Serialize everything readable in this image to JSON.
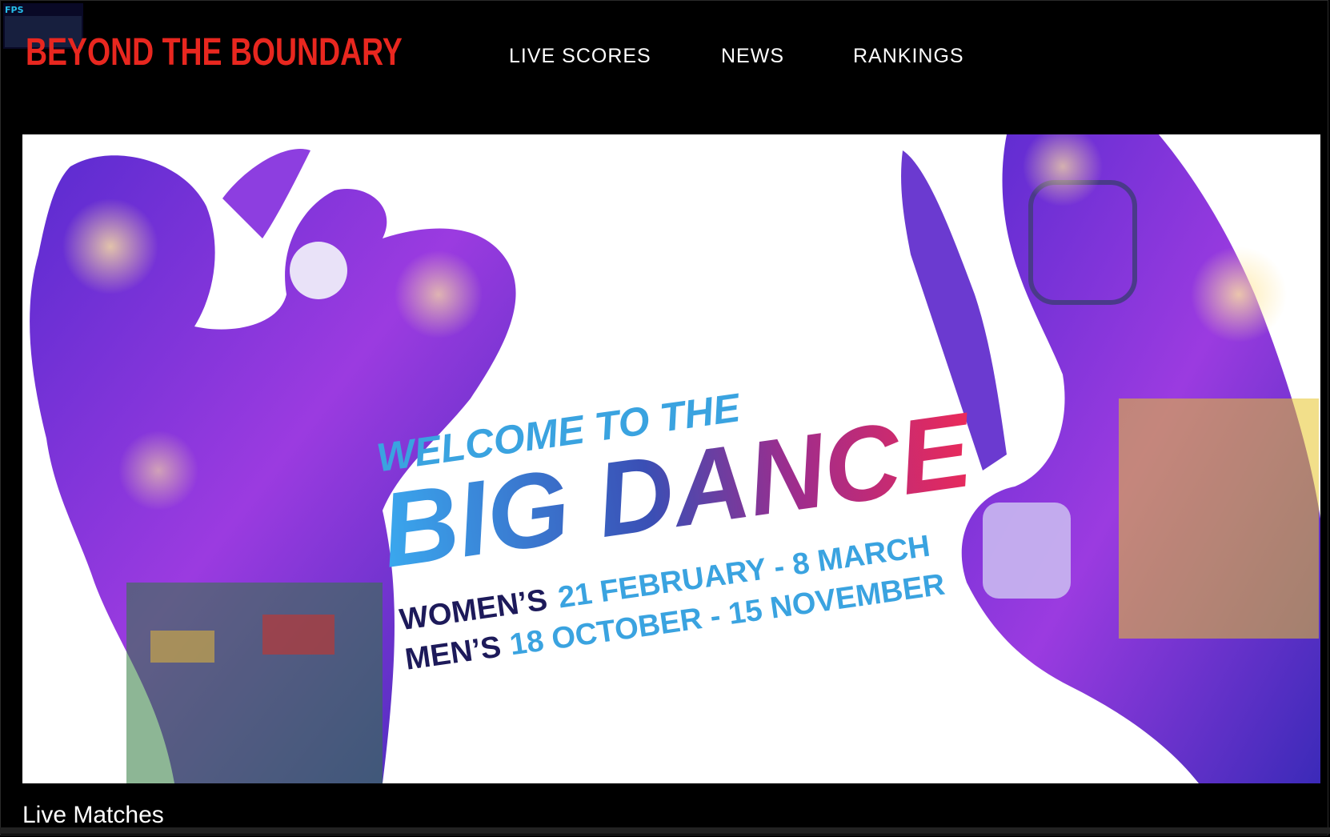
{
  "fps_overlay": {
    "label": "FPS"
  },
  "header": {
    "logo_text": "BEYOND THE BOUNDARY",
    "nav": [
      "LIVE SCORES",
      "NEWS",
      "RANKINGS"
    ]
  },
  "banner": {
    "welcome_line": "WELCOME TO THE",
    "headline": "BIG DANCE",
    "womens_label": "WOMEN’S",
    "womens_dates": "21 FEBRUARY - 8 MARCH",
    "mens_label": "MEN’S",
    "mens_dates": "18 OCTOBER - 15 NOVEMBER"
  },
  "sections": {
    "live_matches_title": "Live Matches"
  },
  "colors": {
    "logo_red": "#e8271f",
    "navy": "#1d1a5a",
    "sky_blue": "#3aa3e0",
    "pink": "#e4285f",
    "purple": "#7a2fc6"
  }
}
